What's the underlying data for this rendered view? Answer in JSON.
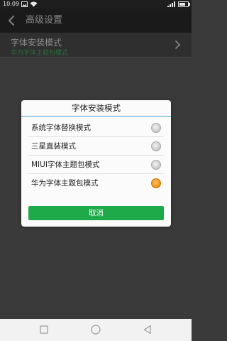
{
  "status_bar": {
    "time": "10:09",
    "battery_level": 0.7
  },
  "header": {
    "title": "高级设置"
  },
  "settings_row": {
    "title": "字体安装模式",
    "value": "华为字体主题包模式"
  },
  "dialog": {
    "title": "字体安装模式",
    "options": [
      {
        "label": "系统字体替换模式",
        "selected": false
      },
      {
        "label": "三星直装模式",
        "selected": false
      },
      {
        "label": "MIUI字体主题包模式",
        "selected": false
      },
      {
        "label": "华为字体主题包模式",
        "selected": true
      }
    ],
    "cancel_label": "取消"
  },
  "colors": {
    "accent_green": "#1faa4a",
    "title_divider_blue": "#4aa3d6",
    "radio_selected_orange": "#f59a20"
  },
  "icons": {
    "back": "back-arrow-icon",
    "chevron": "chevron-right-icon",
    "nav_recent": "square-icon",
    "nav_home": "circle-icon",
    "nav_back": "triangle-back-icon"
  }
}
